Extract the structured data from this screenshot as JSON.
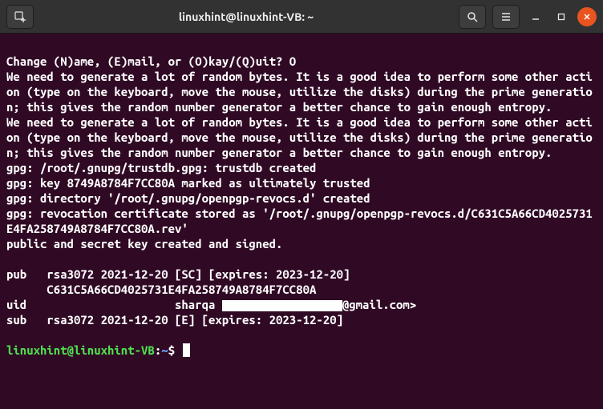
{
  "titlebar": {
    "title": "linuxhint@linuxhint-VB: ~"
  },
  "terminal": {
    "lines": [
      "Change (N)ame, (E)mail, or (O)kay/(Q)uit? O",
      "We need to generate a lot of random bytes. It is a good idea to perform some other action (type on the keyboard, move the mouse, utilize the disks) during the prime generation; this gives the random number generator a better chance to gain enough entropy.",
      "We need to generate a lot of random bytes. It is a good idea to perform some other action (type on the keyboard, move the mouse, utilize the disks) during the prime generation; this gives the random number generator a better chance to gain enough entropy.",
      "gpg: /root/.gnupg/trustdb.gpg: trustdb created",
      "gpg: key 8749A8784F7CC80A marked as ultimately trusted",
      "gpg: directory '/root/.gnupg/openpgp-revocs.d' created",
      "gpg: revocation certificate stored as '/root/.gnupg/openpgp-revocs.d/C631C5A66CD4025731E4FA258749A8784F7CC80A.rev'",
      "public and secret key created and signed.",
      "",
      "pub   rsa3072 2021-12-20 [SC] [expires: 2023-12-20]",
      "      C631C5A66CD4025731E4FA258749A8784F7CC80A"
    ],
    "uid_prefix": "uid                      sharqa ",
    "uid_suffix": "@gmail.com>",
    "sub_line": "sub   rsa3072 2021-12-20 [E] [expires: 2023-12-20]",
    "prompt": {
      "user": "linuxhint@linuxhint-VB",
      "colon": ":",
      "path": "~",
      "dollar": "$"
    }
  }
}
